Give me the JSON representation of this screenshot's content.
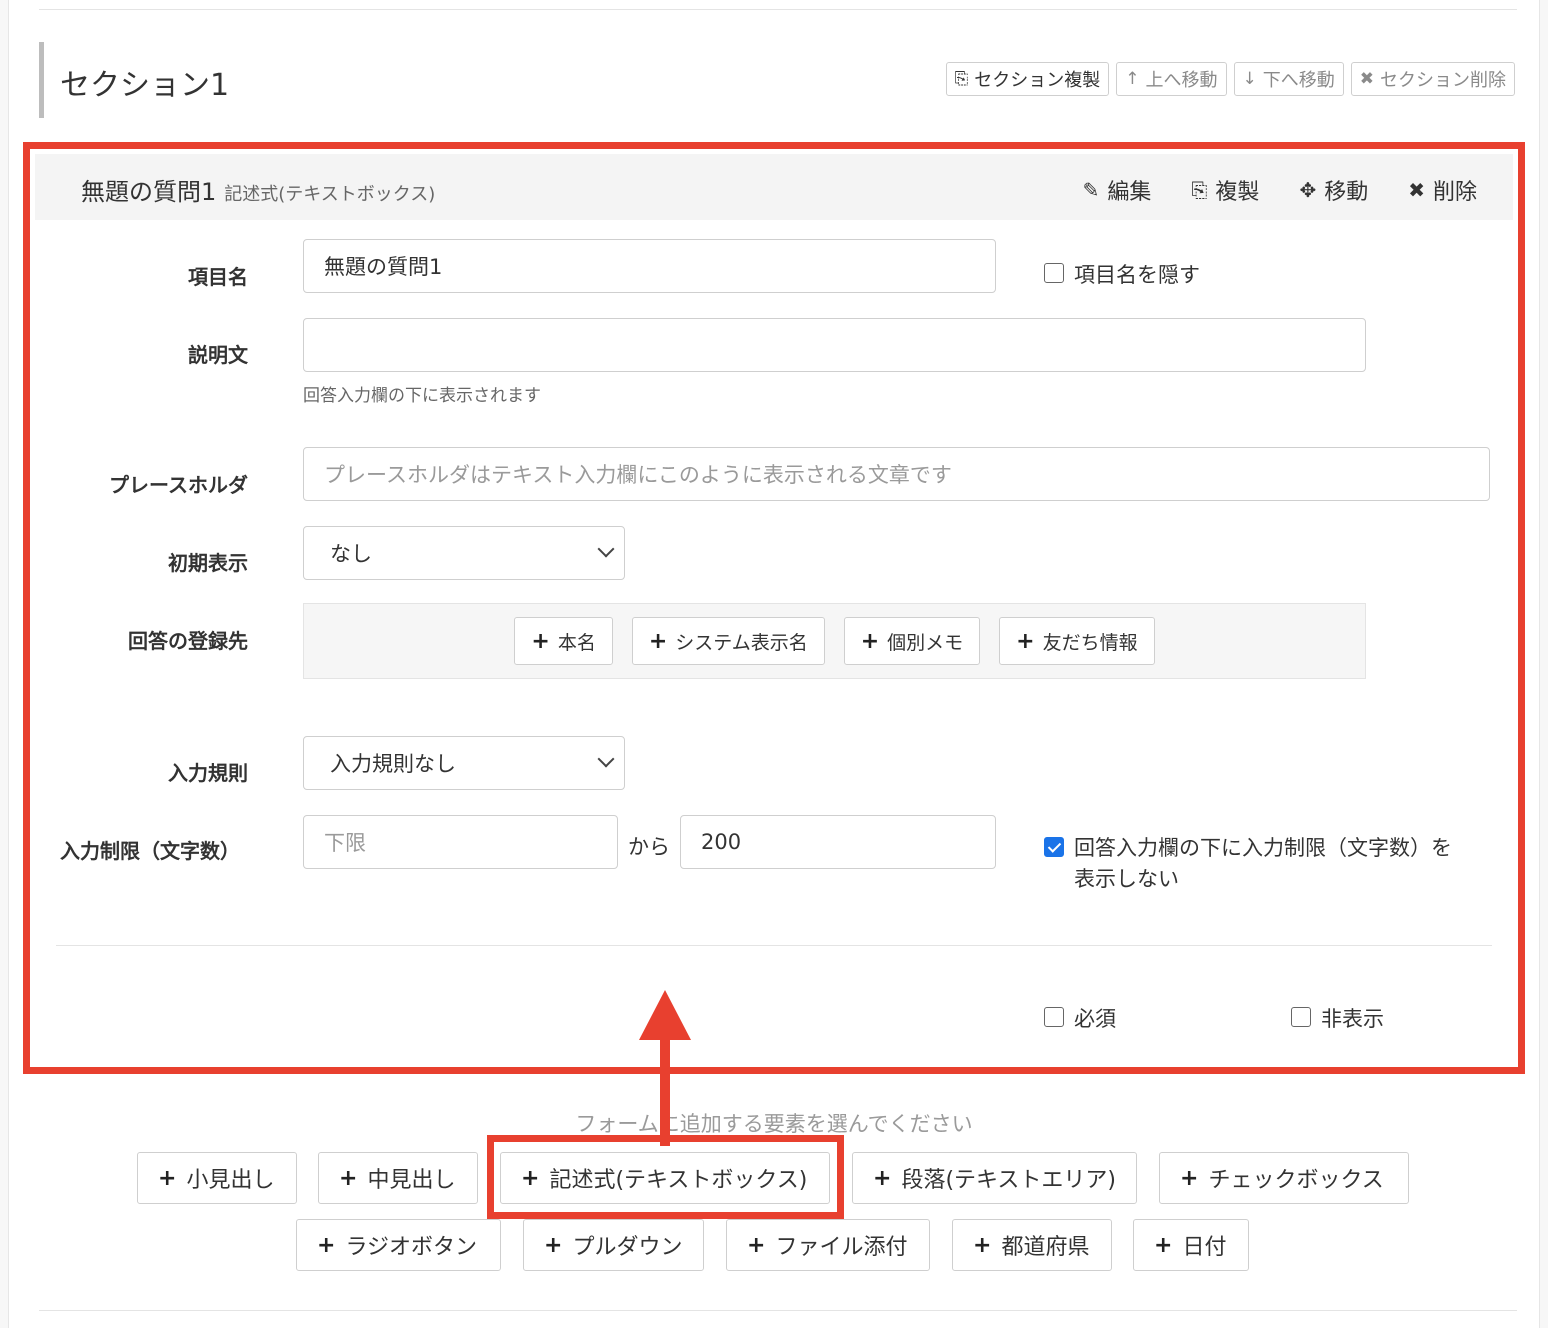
{
  "section": {
    "title": "セクション1",
    "buttons": {
      "duplicate": "セクション複製",
      "move_up": "上へ移動",
      "move_down": "下へ移動",
      "delete": "セクション削除"
    }
  },
  "question": {
    "title": "無題の質問1",
    "type": "記述式(テキストボックス)",
    "actions": {
      "edit": "編集",
      "duplicate": "複製",
      "move": "移動",
      "delete": "削除"
    },
    "fields": {
      "item_name": {
        "label": "項目名",
        "value": "無題の質問1",
        "hide_label": "項目名を隠す",
        "hide_checked": false
      },
      "description": {
        "label": "説明文",
        "value": "",
        "help": "回答入力欄の下に表示されます"
      },
      "placeholder": {
        "label": "プレースホルダ",
        "placeholder": "プレースホルダはテキスト入力欄にこのように表示される文章です"
      },
      "initial": {
        "label": "初期表示",
        "selected": "なし"
      },
      "destination": {
        "label": "回答の登録先",
        "buttons": [
          "本名",
          "システム表示名",
          "個別メモ",
          "友だち情報"
        ]
      },
      "rule": {
        "label": "入力規則",
        "selected": "入力規則なし"
      },
      "limit": {
        "label": "入力制限（文字数）",
        "min_placeholder": "下限",
        "between": "から",
        "max_value": "200",
        "hide_limit_label_line1": "回答入力欄の下に入力制限（文字数）を",
        "hide_limit_label_line2": "表示しない",
        "hide_limit_checked": true
      }
    },
    "footer": {
      "required": "必須",
      "required_checked": false,
      "hidden": "非表示",
      "hidden_checked": false
    }
  },
  "add_elements": {
    "prompt": "フォームに追加する要素を選んでください",
    "row1": [
      "小見出し",
      "中見出し",
      "記述式(テキストボックス)",
      "段落(テキストエリア)",
      "チェックボックス"
    ],
    "row2": [
      "ラジオボタン",
      "プルダウン",
      "ファイル添付",
      "都道府県",
      "日付"
    ]
  },
  "colors": {
    "highlight": "#e8402f",
    "checkbox_on": "#1a73e8"
  }
}
